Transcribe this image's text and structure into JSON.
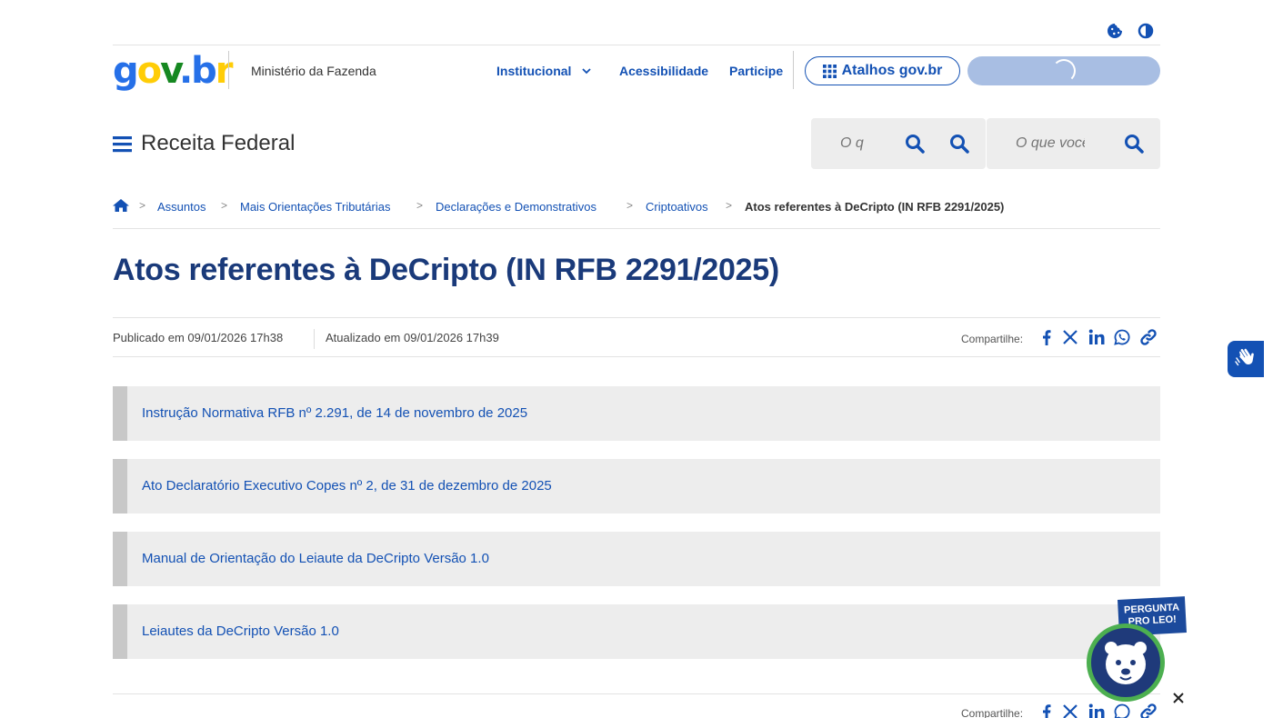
{
  "header": {
    "logo_text": [
      "g",
      "o",
      "v",
      ".",
      "b",
      "r"
    ],
    "logo_colors": [
      "#2670e8",
      "#ffcd07",
      "#168821",
      "#2670e8",
      "#2670e8",
      "#ffcd07"
    ],
    "ministry": "Ministério da Fazenda",
    "nav": [
      {
        "label": "Institucional"
      },
      {
        "label": "Acessibilidade"
      },
      {
        "label": "Participe"
      }
    ],
    "shortcuts_label": "Atalhos gov.br"
  },
  "site": {
    "title": "Receita Federal",
    "search_placeholder_1": "O que você procura?",
    "search_placeholder_2": "O que você procura?"
  },
  "breadcrumb": {
    "items": [
      "Assuntos",
      "Mais Orientações Tributárias",
      "Declarações e Demonstrativos",
      "Criptoativos"
    ],
    "current": "Atos referentes à DeCripto (IN RFB 2291/2025)",
    "separator": ">"
  },
  "page": {
    "title": "Atos referentes à DeCripto (IN RFB 2291/2025)",
    "published": "Publicado em 09/01/2026 17h38",
    "updated": "Atualizado em 09/01/2026 17h39",
    "share_label": "Compartilhe:"
  },
  "documents": [
    {
      "label": "Instrução Normativa RFB nº 2.291, de 14 de novembro de 2025"
    },
    {
      "label": "Ato Declaratório Executivo Copes nº 2, de 31 de dezembro de 2025"
    },
    {
      "label": "Manual de Orientação do Leiaute da DeCripto Versão 1.0"
    },
    {
      "label": "Leiautes da DeCripto Versão 1.0"
    }
  ],
  "leo": {
    "badge_line1": "PERGUNTA",
    "badge_line2": "PRO LEO!"
  },
  "icons": {
    "cookie": "cookie-icon",
    "contrast": "contrast-icon",
    "grid": "grid-icon",
    "menu": "menu-icon",
    "search": "search-icon",
    "home": "home-icon",
    "facebook": "facebook-icon",
    "x": "x-twitter-icon",
    "linkedin": "linkedin-icon",
    "whatsapp": "whatsapp-icon",
    "link": "link-icon",
    "sign_language": "hand-sign-icon",
    "close": "close-icon"
  },
  "colors": {
    "primary": "#1351b4",
    "title": "#1a3a7a",
    "login_button_loading": "#a8bee3"
  }
}
